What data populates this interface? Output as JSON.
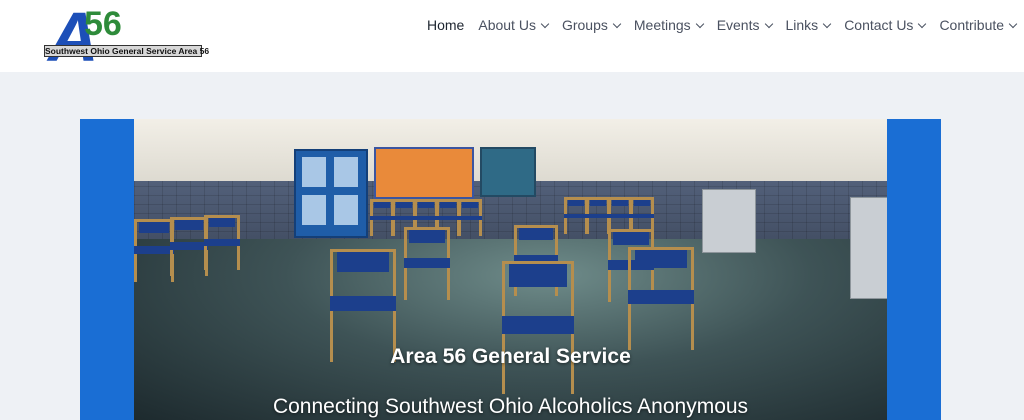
{
  "logo": {
    "letter": "A",
    "number": "56",
    "bar_text": "Southwest Ohio General Service Area 56"
  },
  "nav": {
    "items": [
      {
        "label": "Home",
        "active": true,
        "dropdown": false
      },
      {
        "label": "About Us",
        "active": false,
        "dropdown": true
      },
      {
        "label": "Groups",
        "active": false,
        "dropdown": true
      },
      {
        "label": "Meetings",
        "active": false,
        "dropdown": true
      },
      {
        "label": "Events",
        "active": false,
        "dropdown": true
      },
      {
        "label": "Links",
        "active": false,
        "dropdown": true
      },
      {
        "label": "Contact Us",
        "active": false,
        "dropdown": true
      },
      {
        "label": "Contribute",
        "active": false,
        "dropdown": true
      }
    ]
  },
  "hero": {
    "title": "Area 56 General Service",
    "subtitle": "Connecting Southwest Ohio Alcoholics Anonymous"
  },
  "colors": {
    "hero_blue": "#1a6ed4",
    "logo_blue": "#1d4fb8",
    "logo_green": "#2e8b3a",
    "page_bg": "#eef1f5"
  }
}
